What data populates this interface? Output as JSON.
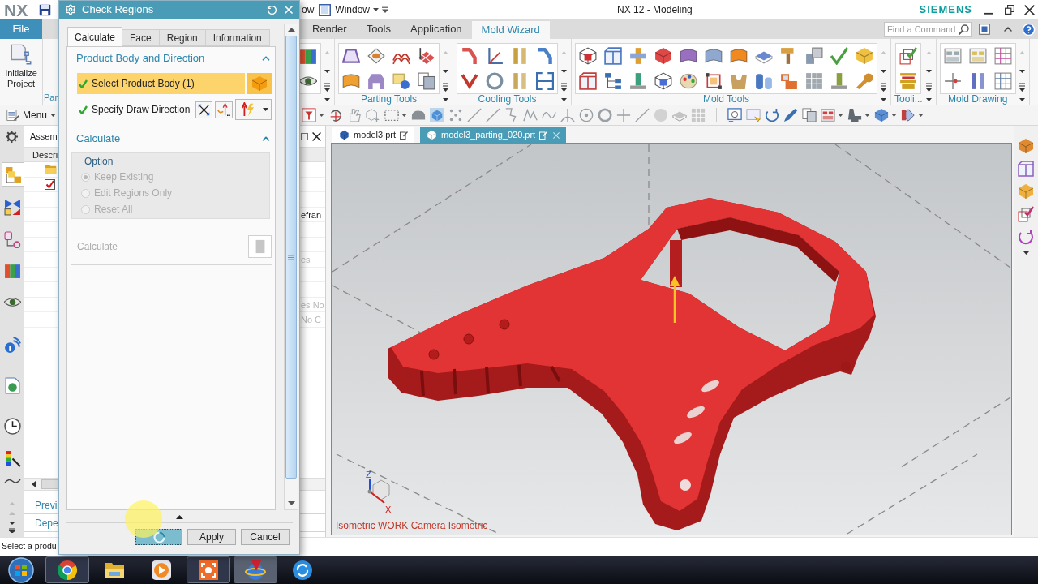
{
  "title_bar": {
    "logo": "NX",
    "clipped_menu": "ow",
    "window_menu": "Window",
    "title": "NX 12 - Modeling",
    "brand": "SIEMENS"
  },
  "ribbon": {
    "file_tab": "File",
    "tabs": [
      {
        "label": "Render",
        "selected": false
      },
      {
        "label": "Tools",
        "selected": false
      },
      {
        "label": "Application",
        "selected": false
      },
      {
        "label": "Mold Wizard",
        "selected": true
      }
    ],
    "search": {
      "placeholder": "Find a Command"
    },
    "project_button": "Initialize Project",
    "groups": [
      {
        "label": "Par"
      },
      {
        "label": "Parting Tools"
      },
      {
        "label": "Cooling Tools"
      },
      {
        "label": "Mold Tools"
      },
      {
        "label": "Tooli..."
      },
      {
        "label": "Mold Drawing"
      }
    ]
  },
  "toolbar": {
    "menu_button": "Menu"
  },
  "resource_bar": {
    "tabs": [
      {
        "selected": true
      },
      {
        "selected": false
      },
      {
        "selected": false
      },
      {
        "selected": false
      },
      {
        "selected": false
      },
      {
        "selected": false
      },
      {
        "selected": false
      },
      {
        "selected": false
      },
      {
        "selected": false
      },
      {
        "selected": false
      }
    ]
  },
  "navigator": {
    "title": "Assem",
    "column_1": "Descri",
    "rows": [
      {
        "kind": "folder"
      },
      {
        "kind": "part",
        "checked": true
      },
      {
        "kind": "blank"
      },
      {
        "kind": "text",
        "column_2": "efran",
        "dim": false
      },
      {
        "kind": "blank"
      },
      {
        "kind": "blank"
      },
      {
        "kind": "text",
        "column_2": "es",
        "dim": true
      },
      {
        "kind": "blank"
      },
      {
        "kind": "blank"
      },
      {
        "kind": "text",
        "column_2": "es No",
        "dim": true
      },
      {
        "kind": "text",
        "column_2": "No C",
        "dim": true
      }
    ],
    "panels": [
      {
        "label": "Previ"
      },
      {
        "label": "Depe"
      }
    ]
  },
  "file_tabs": [
    {
      "label": "model3.prt",
      "selected": false
    },
    {
      "label": "model3_parting_020.prt",
      "selected": true
    }
  ],
  "viewport": {
    "axis_labels": [
      "Z",
      "X"
    ],
    "caption": "Isometric WORK Camera Isometric"
  },
  "dialog": {
    "title": "Check Regions",
    "tabs": [
      {
        "label": "Calculate",
        "selected": true
      },
      {
        "label": "Face",
        "selected": false
      },
      {
        "label": "Region",
        "selected": false
      },
      {
        "label": "Information",
        "selected": false
      }
    ],
    "sections": [
      {
        "kind": "selection",
        "title": "Product Body and Direction",
        "expanded": true,
        "rows": [
          {
            "kind": "body",
            "label": "Select Product Body (1)",
            "done": true,
            "active": true
          },
          {
            "kind": "vector",
            "label": "Specify Draw Direction",
            "done": true,
            "active": false
          }
        ]
      },
      {
        "kind": "calculate",
        "title": "Calculate",
        "expanded": true,
        "option_group": {
          "title": "Option",
          "disabled": true,
          "options": [
            {
              "label": "Keep Existing",
              "selected": true
            },
            {
              "label": "Edit Regions Only",
              "selected": false
            },
            {
              "label": "Reset All",
              "selected": false
            }
          ]
        },
        "action": {
          "label": "Calculate",
          "disabled": true
        }
      }
    ],
    "buttons": [
      {
        "kind": "busy"
      },
      {
        "kind": "text",
        "label": "Apply"
      },
      {
        "kind": "text",
        "label": "Cancel"
      }
    ]
  },
  "status_bar": {
    "prompt": "Select a produ"
  },
  "taskbar": {
    "items": [
      {
        "kind": "browser",
        "open": true,
        "selected": false
      },
      {
        "kind": "folder",
        "open": false,
        "selected": false
      },
      {
        "kind": "media",
        "open": false,
        "selected": false
      },
      {
        "kind": "capture",
        "open": true,
        "selected": false
      },
      {
        "kind": "cad",
        "open": true,
        "selected": true
      },
      {
        "kind": "sync",
        "open": false,
        "selected": false
      }
    ]
  }
}
